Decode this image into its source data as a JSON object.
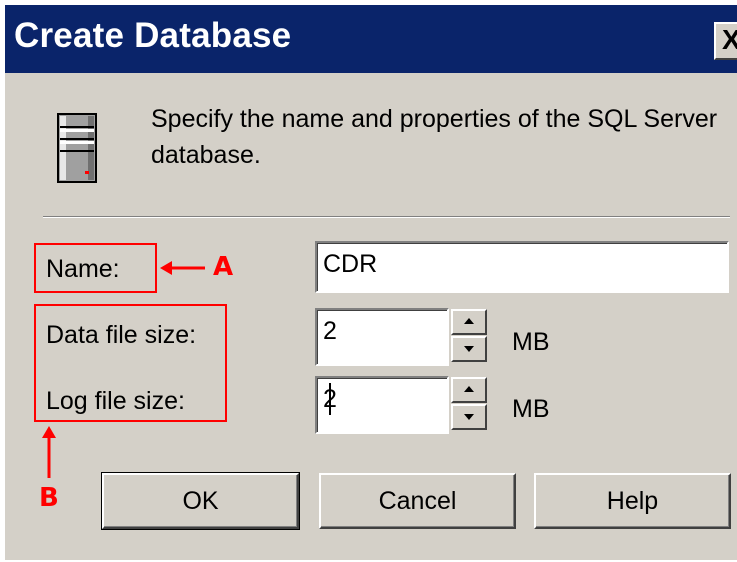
{
  "window": {
    "title": "Create Database",
    "close_label": "X"
  },
  "icons": {
    "database": "server-database-icon",
    "close": "close-icon"
  },
  "header": {
    "description": "Specify the name and properties of the SQL Server database."
  },
  "form": {
    "name_label": "Name:",
    "name_value": "CDR",
    "data_file_size_label": "Data file size:",
    "data_file_size_value": "2",
    "data_file_unit": "MB",
    "log_file_size_label": "Log file size:",
    "log_file_size_value": "2",
    "log_file_unit": "MB"
  },
  "annotations": {
    "a_label": "A",
    "b_label": "B",
    "color": "#ff0000"
  },
  "buttons": {
    "ok": "OK",
    "cancel": "Cancel",
    "help": "Help"
  },
  "colors": {
    "titlebar": "#0a246a",
    "dialog_bg": "#d4d0c8"
  }
}
